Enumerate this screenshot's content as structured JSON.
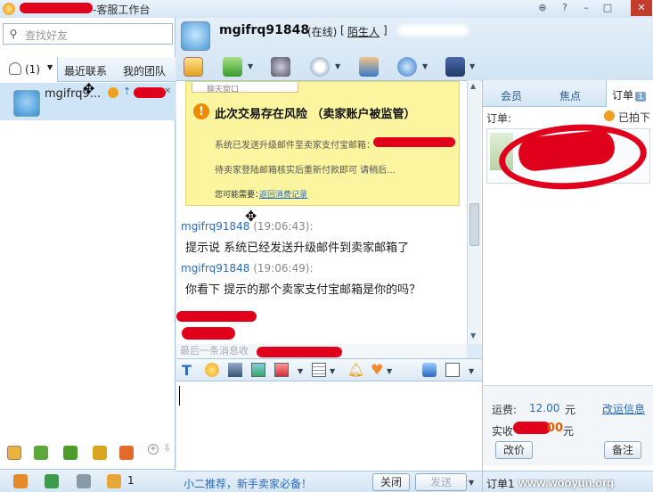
{
  "window": {
    "title": "-客服工作台",
    "buttons": [
      "⊕",
      "?",
      "–",
      "□",
      "✕"
    ]
  },
  "left": {
    "search_placeholder": "查找好友",
    "tabs": {
      "contacts": "(1)",
      "recent": "最近联系",
      "team": "我的团队"
    },
    "contact": {
      "name": "mgifrq9..."
    }
  },
  "header": {
    "peer_name": "mgifrq91848",
    "status": "(在线)",
    "stranger": "陌生人",
    "bracket_open": "[",
    "bracket_close": "]"
  },
  "warning": {
    "header": "聊天窗口",
    "title": "此次交易存在风险 （卖家账户被监管）",
    "line1": "系统已发送升级邮件至卖家支付宝邮箱：",
    "line2": "待卖家登陆邮箱核实后重新付款即可  请稍后...",
    "line3_label": "您可能需要：",
    "line3_link": "返回消费记录"
  },
  "messages": [
    {
      "sender": "mgifrq91848",
      "time": "(19:06:43):",
      "text": "提示说 系统已经发送升级邮件到卖家邮箱了"
    },
    {
      "sender": "mgifrq91848",
      "time": "(19:06:49):",
      "text": "你看下 提示的那个卖家支付宝邮箱是你的吗？"
    }
  ],
  "last_message": "最后一条消息收",
  "footer": {
    "promo": "小二推荐，新手卖家必备！",
    "close": "关闭",
    "send": "发送",
    "counter": "1"
  },
  "right": {
    "tabs": {
      "member": "会员",
      "focus": "焦点",
      "order": "订单",
      "order_count": "1"
    },
    "order_label": "订单:",
    "order_status": "已拍下",
    "fee_label": "运费:",
    "fee_value": "12.00",
    "fee_unit": "元",
    "fee_link": "改运信息",
    "paid_label": "实收",
    "paid_value": "00",
    "paid_unit": "元",
    "modify_price": "改价",
    "note": "备注",
    "order_tab": "订单",
    "order_tab_count": "1",
    "watermark": "www.wooyun.org"
  },
  "colors": {
    "accent": "#2a6ac0",
    "redaction": "#e0001b",
    "warning_bg": "#fbf5a0"
  }
}
